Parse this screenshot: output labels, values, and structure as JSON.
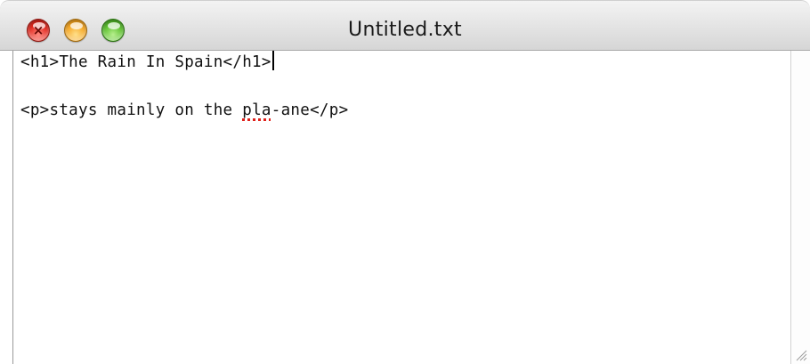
{
  "window": {
    "title": "Untitled.txt",
    "close_mark": "×"
  },
  "document": {
    "line1": "<h1>The Rain In Spain</h1>",
    "line2_before": "<p>stays mainly on the ",
    "line2_misspelled": "pla",
    "line2_after": "-ane</p>"
  },
  "colors": {
    "close": "#e2261c",
    "minimize": "#f5a623",
    "zoom": "#5bbf2d",
    "spellcheck_underline": "#e0201a"
  },
  "icons": {
    "close": "close-icon",
    "minimize": "minimize-icon",
    "zoom": "zoom-icon",
    "resize": "resize-grip-icon"
  }
}
